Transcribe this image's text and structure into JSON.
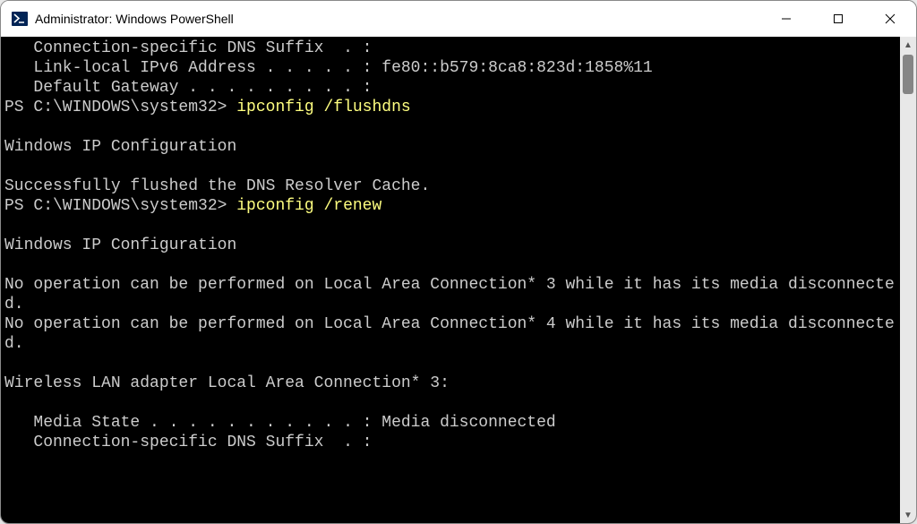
{
  "window": {
    "title": "Administrator: Windows PowerShell"
  },
  "terminal": {
    "line1": "   Connection-specific DNS Suffix  . :",
    "line2": "   Link-local IPv6 Address . . . . . : fe80::b579:8ca8:823d:1858%11",
    "line3": "   Default Gateway . . . . . . . . . :",
    "prompt1": "PS C:\\WINDOWS\\system32> ",
    "cmd1": "ipconfig /flushdns",
    "blank": "",
    "ipconfig_header1": "Windows IP Configuration",
    "flush_result": "Successfully flushed the DNS Resolver Cache.",
    "prompt2": "PS C:\\WINDOWS\\system32> ",
    "cmd2": "ipconfig /renew",
    "ipconfig_header2": "Windows IP Configuration",
    "noop1": "No operation can be performed on Local Area Connection* 3 while it has its media disconnected.",
    "noop2": "No operation can be performed on Local Area Connection* 4 while it has its media disconnected.",
    "adapter_header": "Wireless LAN adapter Local Area Connection* 3:",
    "media_state": "   Media State . . . . . . . . . . . : Media disconnected",
    "dns_suffix2": "   Connection-specific DNS Suffix  . :"
  }
}
